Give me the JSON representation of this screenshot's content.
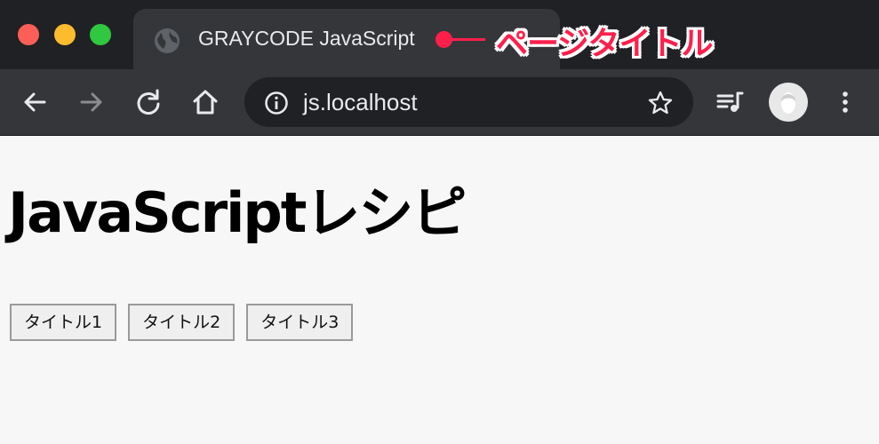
{
  "browser": {
    "tab_title": "GRAYCODE JavaScript",
    "new_tab_symbol": "+",
    "url": "js.localhost",
    "annotation": "ページタイトル",
    "annotation_color": "#ff1f4b",
    "icons": [
      "back-icon",
      "forward-icon",
      "reload-icon",
      "home-icon",
      "info-icon",
      "star-icon",
      "media-queue-icon",
      "avatar",
      "menu-icon"
    ]
  },
  "page": {
    "heading": "JavaScriptレシピ",
    "buttons": [
      {
        "label": "タイトル1"
      },
      {
        "label": "タイトル2"
      },
      {
        "label": "タイトル3"
      }
    ]
  }
}
